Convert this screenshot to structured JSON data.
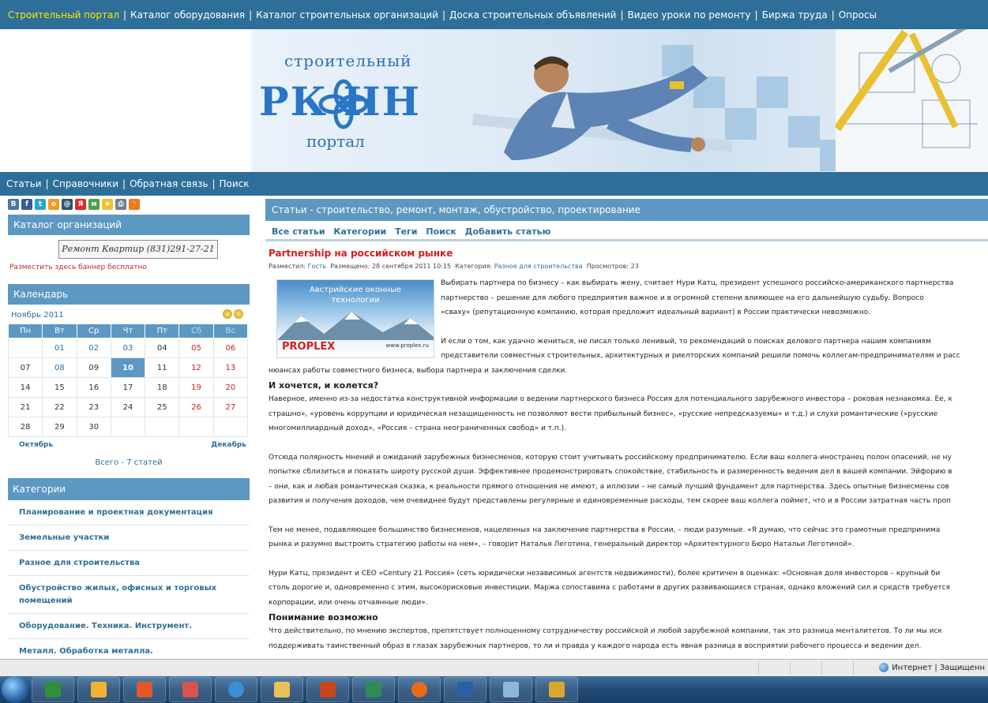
{
  "topnav": {
    "items": [
      "Строительный портал",
      "Каталог оборудования",
      "Каталог строительных организаций",
      "Доска строительных объявлений",
      "Видео уроки по ремонту",
      "Биржа труда",
      "Опросы"
    ],
    "separator": "|",
    "accent": "#ffe600"
  },
  "header": {
    "logo_top": "строительный",
    "logo_main": "РК НН",
    "logo_sub": "портал"
  },
  "subnav": {
    "items": [
      "Статьи",
      "Справочники",
      "Обратная связь",
      "Поиск"
    ],
    "separator": "|"
  },
  "social_icons": [
    "vkontakte-icon",
    "facebook-icon",
    "twitter-icon",
    "odnoklassniki-icon",
    "mailru-icon",
    "yandex-icon",
    "moimir-icon",
    "favorites-icon",
    "print-icon",
    "rss-icon"
  ],
  "sidebar": {
    "org_title": "Каталог организаций",
    "org_banner": "Ремонт Квартир (831)291-27-21",
    "org_link": "Разместить здесь баннер бесплатно",
    "calendar_title": "Календарь",
    "month": "Ноябрь 2011",
    "weekdays": [
      "Пн",
      "Вт",
      "Ср",
      "Чт",
      "Пт",
      "Сб",
      "Вс"
    ],
    "weeks": [
      [
        "",
        "01",
        "02",
        "03",
        "04",
        "05",
        "06"
      ],
      [
        "07",
        "08",
        "09",
        "10",
        "11",
        "12",
        "13"
      ],
      [
        "14",
        "15",
        "16",
        "17",
        "18",
        "19",
        "20"
      ],
      [
        "21",
        "22",
        "23",
        "24",
        "25",
        "26",
        "27"
      ],
      [
        "28",
        "29",
        "30",
        "",
        "",
        "",
        ""
      ]
    ],
    "today": "10",
    "prev_month": "Октябрь",
    "next_month": "Декабрь",
    "total": "Всего - 7 статей",
    "categories_title": "Категории",
    "categories": [
      "Планирование и проектная документация",
      "Земельные участки",
      "Разное для строительства",
      "Обустройство жилых, офисных и торговых помещений",
      "Оборудование. Техника. Инструмент.",
      "Металл. Обработка металла."
    ]
  },
  "main": {
    "heading": "Статьи - строительство, ремонт, монтаж, обустройство, проектирование",
    "tabs": [
      "Все статьи",
      "Категории",
      "Теги",
      "Поиск",
      "Добавить статью"
    ],
    "article_title": "Partnership на российском рынке",
    "meta": {
      "posted_label": "Разместил:",
      "author": "Гость",
      "date_label": "Размещено: 28 сентября 2011 10:15",
      "category_label": "Категория:",
      "category": "Разное для строительства",
      "views_label": "Просмотров: 23"
    },
    "ad": {
      "line1": "Австрийские оконные",
      "line2": "технологии",
      "brand": "PROPLEX",
      "site": "www.proplex.ru"
    },
    "intro_lines": [
      "Выбирать партнера по бизнесу – как выбирать жену, считает Нури Катц, президент успешного российско-американского партнерства",
      "партнерство – решение для любого предприятия важное и в огромной степени влияющее на его дальнейшую судьбу. Вопросо",
      "«сваху» (репутационную компанию, которая предложит идеальный вариант) в России практически невозможно."
    ],
    "para2_lines": [
      "И если о том, как удачно жениться, не писал только ленивый, то рекомендаций о поисках делового партнера нашим компаниям",
      "представители совместных строительных, архитектурных и риелторских компаний решили помочь коллегам-предпринимателям и расс",
      "нюансах работы совместного бизнеса, выбора партнера и заключения сделки."
    ],
    "h_1": "И хочется, и колется?",
    "para3_lines": [
      "Наверное, именно из-за недостатка конструктивной информации о ведении партнерского бизнеса Россия для потенциального зарубежного инвестора – роковая незнакомка. Ее, к",
      "страшно», «уровень коррупции и юридическая незащищенность не позволяют вести прибыльный бизнес», «русские непредсказуемы» и т.д.) и слухи романтические («русские",
      "многомиллиардный доход», «Россия – страна неограниченных свобод» и т.п.)."
    ],
    "para4_lines": [
      "Отсюда полярность мнений и ожиданий зарубежных бизнесменов, которую стоит учитывать российскому предпринимателю. Если ваш коллега-иностранец полон опасений, не ну",
      "попытке сблизиться и показать широту русской души. Эффективнее продемонстрировать спокойствие, стабильность и размеренность ведения дел в вашей компании. Эйфорию в",
      "– они, как и любая романтическая сказка, к реальности прямого отношения не имеют, а иллюзии – не самый лучший фундамент для партнерства. Здесь опытные бизнесмены сов",
      "развития и получения доходов, чем очевиднее будут представлены регулярные и единовременные расходы, тем скорее ваш коллега поймет, что и в России затратная часть проп"
    ],
    "para5_lines": [
      "Тем не менее, подавляющее большинство бизнесменов, нацеленных на заключение партнерства в России, – люди разумные. «Я думаю, что сейчас это грамотные предпринима",
      "рынка и разумно выстроить стратегию работы на нем», – говорит Наталья Леготина, генеральный директор «Архитектурного Бюро Натальи Леготиной»."
    ],
    "para6_lines": [
      "Нури Катц, президент и CEO «Century 21 Россия» (сеть юридически независимых агентств недвижимости), более критичен в оценках: «Основная доля инвесторов – крупный би",
      "столь дорогие и, одновременно с этим, высокорисковые инвестиции. Маржа сопоставима с работами в других развивающихся странах, однако вложений сил и средств требуется",
      "корпорации, или очень отчаянные люди»."
    ],
    "h_2": "Понимание возможно",
    "para7_lines": [
      "Что действительно, по мнению экспертов, препятствует полноценному сотрудничеству российской и любой зарубежной компании, так это разница менталитетов. То ли мы иск",
      "поддерживать таинственный образ в глазах зарубежных партнеров, то ли и правда у каждого народа есть явная разница в восприятии рабочего процесса и ведении дел."
    ]
  },
  "statusbar": {
    "zone": "Интернет | Защищенн"
  }
}
